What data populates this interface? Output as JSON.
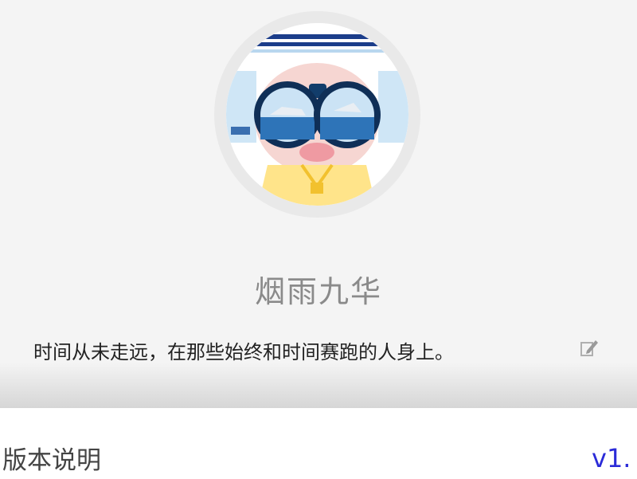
{
  "profile": {
    "username": "烟雨九华",
    "signature": "时间从未走远，在那些始终和时间赛跑的人身上。",
    "avatar_icon": "binoculars-character-avatar",
    "edit_icon": "edit-icon"
  },
  "version": {
    "label": "版本说明",
    "value": "v1."
  },
  "colors": {
    "header_bg": "#f4f4f4",
    "username": "#8a8a8a",
    "signature": "#222222",
    "version_value": "#2b2bd8"
  }
}
